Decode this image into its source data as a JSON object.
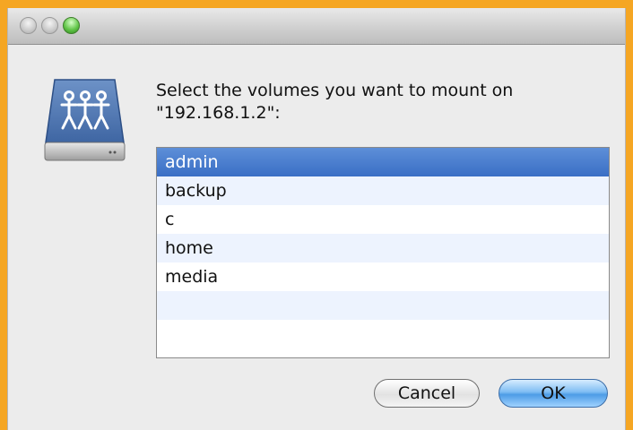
{
  "window": {
    "controls": [
      {
        "name": "close",
        "icon": "close-button-icon"
      },
      {
        "name": "minimize",
        "icon": "minimize-button-icon"
      },
      {
        "name": "zoom",
        "icon": "zoom-button-icon"
      }
    ]
  },
  "dialog": {
    "icon": "network-volume-icon",
    "prompt": "Select the volumes you want to mount on \"192.168.1.2\":",
    "volumes": [
      {
        "label": "admin",
        "selected": true
      },
      {
        "label": "backup",
        "selected": false
      },
      {
        "label": "c",
        "selected": false
      },
      {
        "label": "home",
        "selected": false
      },
      {
        "label": "media",
        "selected": false
      },
      {
        "label": "",
        "selected": false
      },
      {
        "label": "",
        "selected": false
      }
    ],
    "cancel_label": "Cancel",
    "ok_label": "OK"
  },
  "colors": {
    "selection": "#3a6fc5",
    "alt_row": "#edf3fe",
    "ok_button": "#4d9ce6",
    "frame_accent": "#f5a623"
  }
}
